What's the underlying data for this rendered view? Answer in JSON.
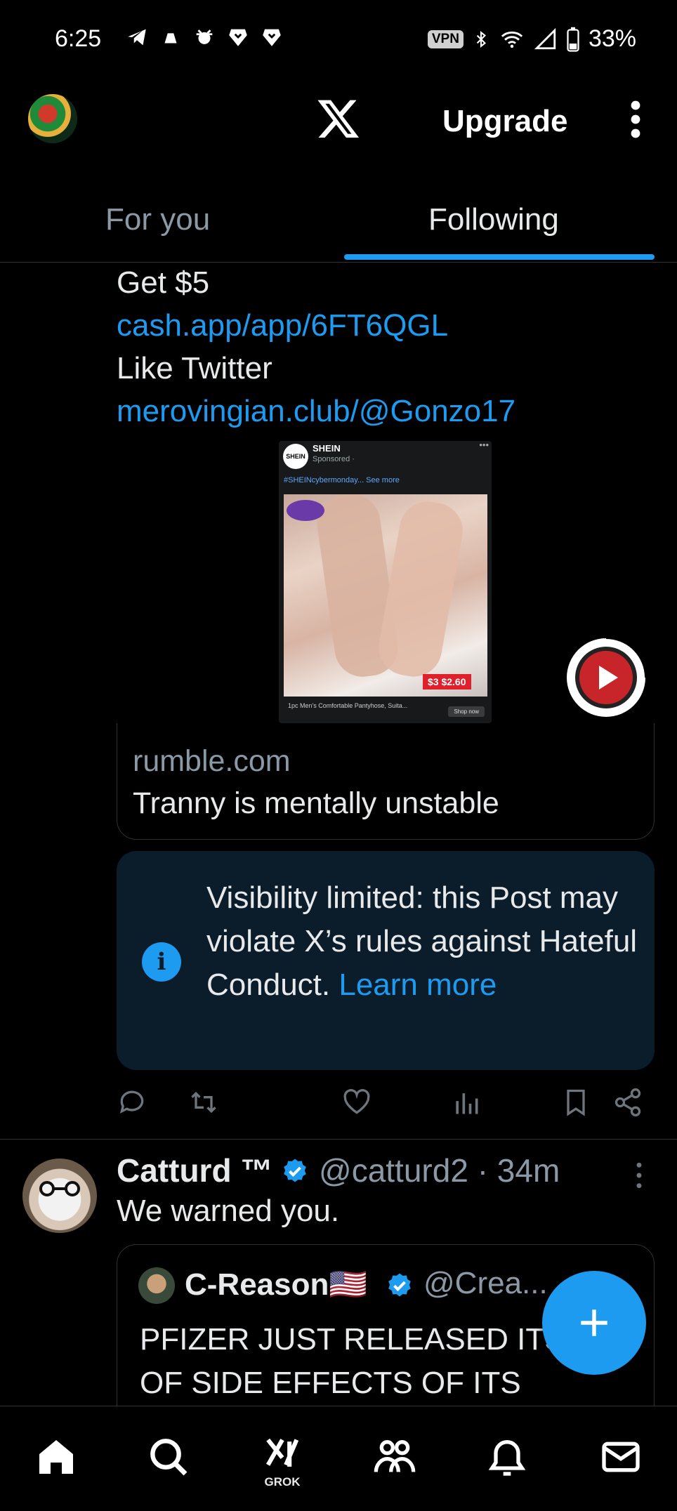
{
  "status_bar": {
    "time": "6:25",
    "vpn": "VPN",
    "battery": "33%",
    "left_icons": [
      "telegram-icon",
      "drive-icon",
      "bug-icon",
      "brave-icon",
      "brave-icon"
    ],
    "right_icons": [
      "bluetooth-icon",
      "wifi-icon",
      "signal-icon",
      "battery-icon"
    ]
  },
  "header": {
    "upgrade": "Upgrade",
    "logo": "x-logo-icon",
    "menu": "kebab-icon"
  },
  "tabs": [
    {
      "label": "For you",
      "active": false
    },
    {
      "label": "Following",
      "active": true
    }
  ],
  "tweet1": {
    "lines": [
      {
        "text": "Get $5",
        "link": false
      },
      {
        "text": "cash.app/app/6FT6QGL",
        "link": true
      },
      {
        "text": "Like Twitter",
        "link": false
      },
      {
        "text": "merovingian.club/@Gonzo17",
        "link": true
      }
    ],
    "ad": {
      "logo": "SHEIN",
      "brand": "SHEIN",
      "sponsored": "Sponsored · ",
      "hashtag": "#SHEINcybermonday... See more",
      "price": "$3 $2.60",
      "caption": "1pc Men's Comfortable Pantyhose, Suita...",
      "shop": "Shop now"
    },
    "link_card": {
      "domain": "rumble.com",
      "title": "Tranny is mentally unstable"
    },
    "notice": {
      "text": "Visibility limited: this Post may violate X’s rules against Hateful Conduct.",
      "link": "Learn more"
    },
    "actions": [
      "reply-icon",
      "repost-icon",
      "like-icon",
      "views-icon",
      "bookmark-icon",
      "share-icon"
    ]
  },
  "tweet2": {
    "name": "Catturd ™",
    "handle": "@catturd2 · 34m",
    "text": "We warned you.",
    "quote": {
      "name": "C-Reason🇺🇸",
      "handle": "@Crea...",
      "text": "PFIZER JUST RELEASED ITS LIST OF SIDE EFFECTS OF ITS"
    }
  },
  "bottom_nav": {
    "items": [
      "home-icon",
      "search-icon",
      "grok-icon",
      "communities-icon",
      "notifications-icon",
      "messages-icon"
    ],
    "grok_label": "GROK"
  },
  "colors": {
    "accent": "#1d9bf0",
    "background": "#000000",
    "notice_bg": "#0b1d2b",
    "secondary_text": "#8b98a5"
  }
}
